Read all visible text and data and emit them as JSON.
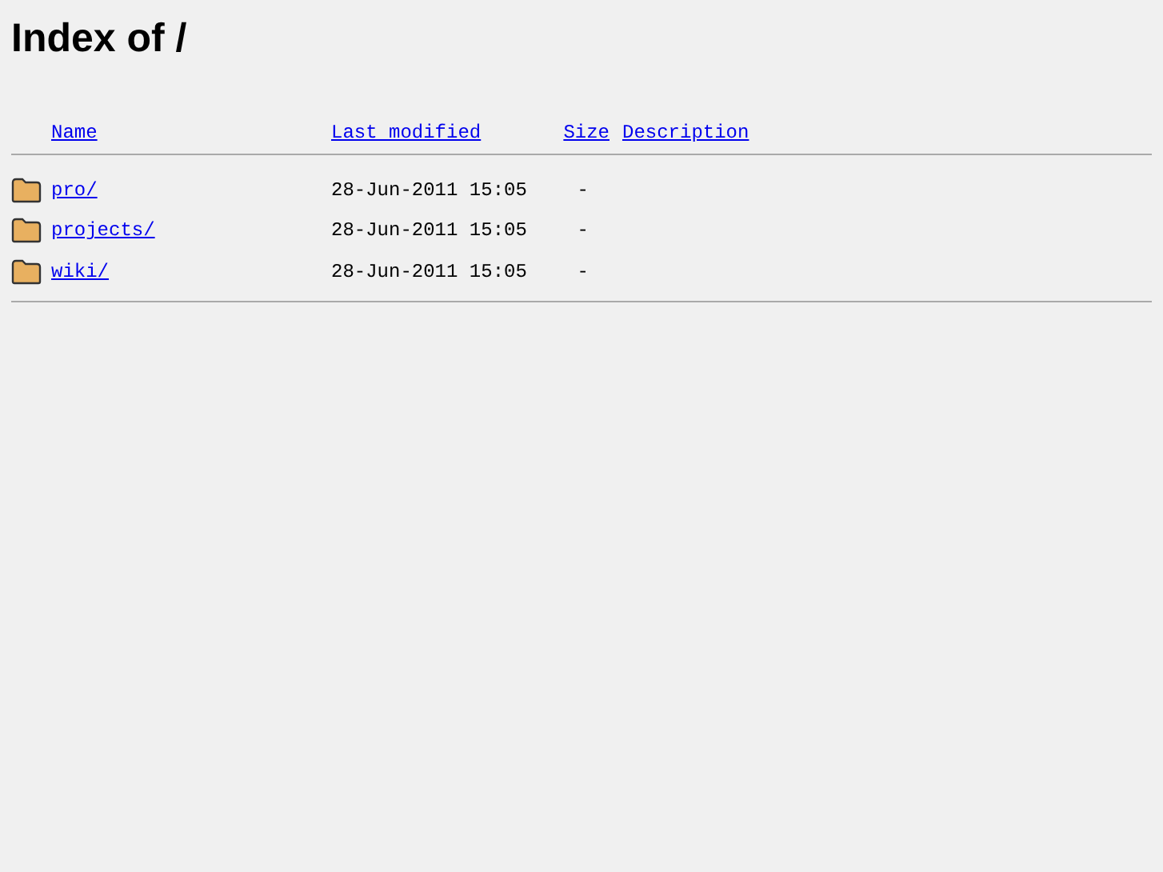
{
  "title": "Index of /",
  "columns": [
    "Name",
    "Last modified",
    "Size",
    "Description"
  ],
  "rows": [
    {
      "name": "pro/",
      "modified": "28-Jun-2011 15:05",
      "size": "-"
    },
    {
      "name": "projects/",
      "modified": "28-Jun-2011 15:05",
      "size": "-"
    },
    {
      "name": "wiki/",
      "modified": "28-Jun-2011 15:05",
      "size": "-"
    }
  ]
}
